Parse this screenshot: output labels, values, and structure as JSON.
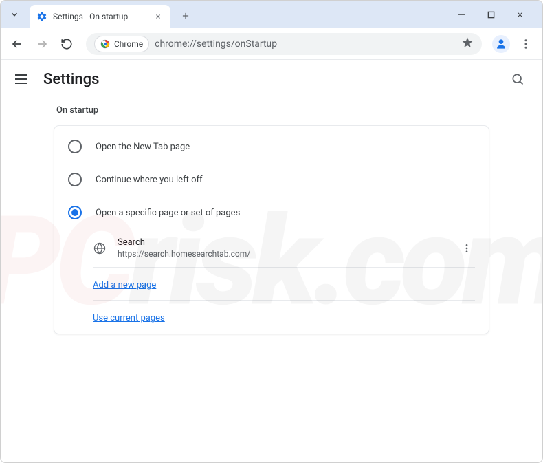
{
  "tab": {
    "title": "Settings - On startup"
  },
  "omnibox": {
    "chip_label": "Chrome",
    "url": "chrome://settings/onStartup"
  },
  "settings": {
    "title": "Settings",
    "section_title": "On startup",
    "options": {
      "new_tab": "Open the New Tab page",
      "continue": "Continue where you left off",
      "specific": "Open a specific page or set of pages"
    },
    "pages": [
      {
        "name": "Search",
        "url": "https://search.homesearchtab.com/"
      }
    ],
    "links": {
      "add_page": "Add a new page",
      "use_current": "Use current pages"
    }
  },
  "watermark": {
    "prefix": "PC",
    "suffix": "risk.com"
  }
}
